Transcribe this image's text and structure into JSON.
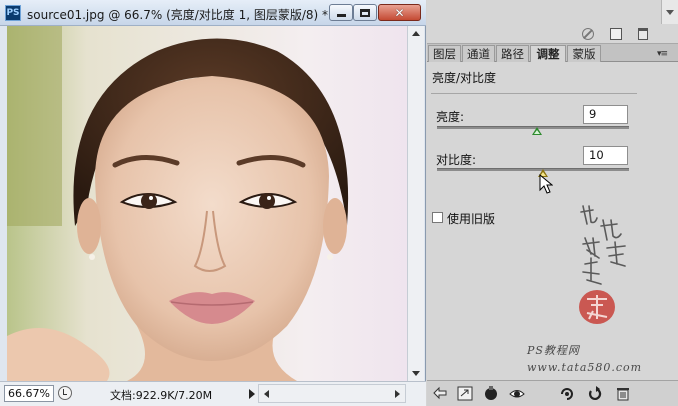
{
  "window": {
    "app_icon": "PS",
    "title": "source01.jpg @ 66.7% (亮度/对比度 1, 图层蒙版/8) *",
    "close_glyph": "✕"
  },
  "status": {
    "zoom": "66.67%",
    "doc_info": "文档:922.9K/7.20M"
  },
  "panel": {
    "tabs": [
      "图层",
      "通道",
      "路径",
      "调整",
      "蒙版"
    ],
    "active_tab": 3,
    "menu_glyph": "▾≡",
    "adjustment_title": "亮度/对比度",
    "brightness": {
      "label": "亮度:",
      "value": "9",
      "level": 0.52
    },
    "contrast": {
      "label": "对比度:",
      "value": "10",
      "level": 0.55
    },
    "legacy": {
      "label": "使用旧版",
      "checked": false
    },
    "watermark": {
      "seal_text": "",
      "site_name": "PS教程网",
      "url": "www.tata580.com"
    }
  },
  "icons": {
    "top": [
      "no-icon",
      "new-layer-icon",
      "trash-icon"
    ],
    "bottom": [
      "back-arrow-icon",
      "expand-view-icon",
      "clip-layer-icon",
      "visibility-eye-icon",
      "view-previous-icon",
      "reset-icon",
      "trash-icon"
    ]
  },
  "colors": {
    "panel_bg": "#d6d6d6",
    "title_bar": "#c7d6e9",
    "close_button": "#c44a33",
    "slider_thumb_brightness": "#2d8a2d",
    "slider_thumb_contrast": "#8c7410"
  }
}
